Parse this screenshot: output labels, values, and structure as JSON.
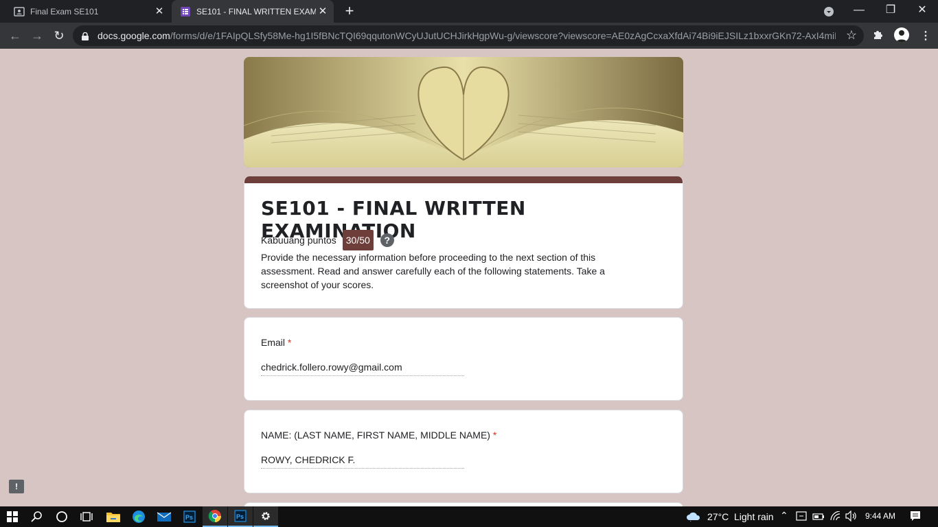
{
  "browser": {
    "tabs": [
      {
        "title": "Final Exam SE101",
        "icon": "classroom-icon"
      },
      {
        "title": "SE101 - FINAL WRITTEN EXAMIN",
        "icon": "forms-icon"
      }
    ],
    "url_host": "docs.google.com",
    "url_path": "/forms/d/e/1FAIpQLSfy58Me-hg1I5fBNcTQI69qqutonWCyUJutUCHJirkHgpWu-g/viewscore?viewscore=AE0zAgCcxaXfdAi74Bi9iEJSILz1bxxrGKn72-AxI4miFY..."
  },
  "form": {
    "title": "SE101 - FINAL WRITTEN EXAMINATION",
    "points_label": "Kabuuang puntos",
    "score": "30/50",
    "help": "?",
    "description": "Provide the necessary information before proceeding to the next section of this assessment. Read and answer carefully each of the following statements. Take a screenshot of your scores.",
    "questions": [
      {
        "label": "Email",
        "required": "*",
        "answer": "chedrick.follero.rowy@gmail.com"
      },
      {
        "label": "NAME: (LAST NAME, FIRST NAME, MIDDLE NAME)",
        "required": "*",
        "answer": "ROWY, CHEDRICK F."
      }
    ],
    "theme_color": "#6e3f3a",
    "background_color": "#d7c5c4"
  },
  "taskbar": {
    "weather_temp": "27°C",
    "weather_desc": "Light rain",
    "time": "9:44 AM"
  }
}
